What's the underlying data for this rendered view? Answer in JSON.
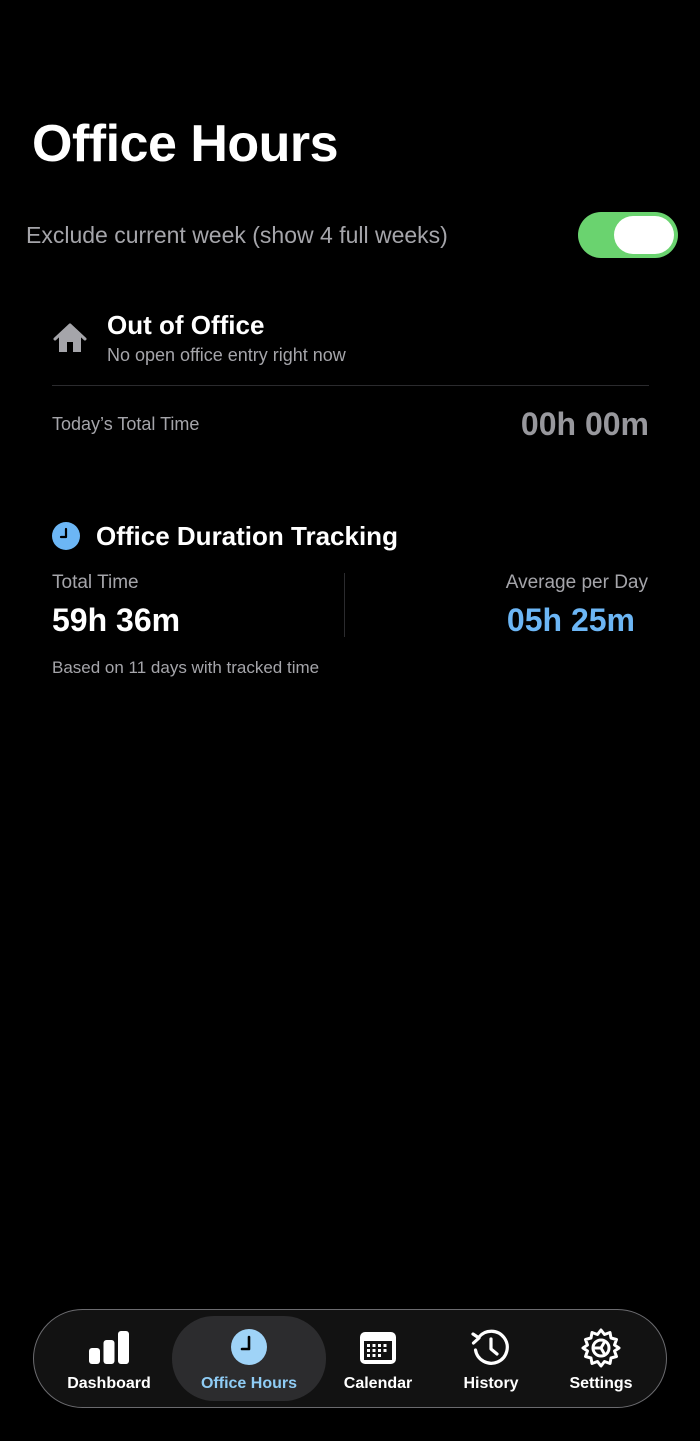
{
  "header": {
    "title": "Office Hours"
  },
  "filter": {
    "exclude_current_week_label": "Exclude current week (show 4 full weeks)",
    "exclude_current_week_enabled": true
  },
  "status": {
    "icon": "house-icon",
    "title": "Out of Office",
    "subtitle": "No open office entry right now",
    "today_label": "Today’s Total Time",
    "today_value": "00h 00m"
  },
  "tracking": {
    "icon": "clock-icon",
    "title": "Office Duration Tracking",
    "total_label": "Total Time",
    "total_value": "59h 36m",
    "average_label": "Average per Day",
    "average_value": "05h 25m",
    "footnote": "Based on 11 days with tracked time"
  },
  "tab_bar": {
    "active": "Office Hours",
    "items": [
      {
        "label": "Dashboard",
        "icon": "bar-chart-icon"
      },
      {
        "label": "Office Hours",
        "icon": "clock-icon"
      },
      {
        "label": "Calendar",
        "icon": "calendar-icon"
      },
      {
        "label": "History",
        "icon": "history-icon"
      },
      {
        "label": "Settings",
        "icon": "gear-icon"
      }
    ]
  },
  "colors": {
    "background": "#000000",
    "toggle_on": "#6ad36f",
    "accent_blue": "#6cb6f5",
    "active_tab_text": "#8fccf5",
    "secondary_text": "#a5a5aa"
  }
}
